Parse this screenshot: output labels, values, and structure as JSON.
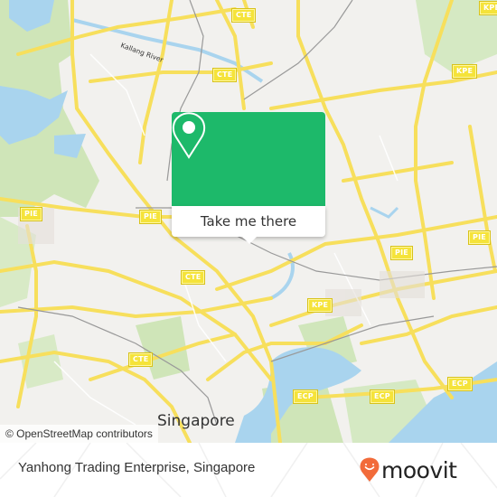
{
  "map": {
    "city_label": "Singapore",
    "river_label": "Kallang River",
    "attribution": "© OpenStreetMap contributors",
    "colors": {
      "land": "#f2f1ee",
      "park": "#cfe5b8",
      "water": "#a9d4ee",
      "major_road": "#f7df5c",
      "rail": "#999999"
    },
    "highway_shields": [
      {
        "label": "CTE"
      },
      {
        "label": "CTE"
      },
      {
        "label": "CTE"
      },
      {
        "label": "CTE"
      },
      {
        "label": "KPE"
      },
      {
        "label": "KPE"
      },
      {
        "label": "KPE"
      },
      {
        "label": "PIE"
      },
      {
        "label": "PIE"
      },
      {
        "label": "PIE"
      },
      {
        "label": "PIE"
      },
      {
        "label": "PIE"
      },
      {
        "label": "ECP"
      },
      {
        "label": "ECP"
      },
      {
        "label": "ECP"
      }
    ]
  },
  "popup": {
    "button_label": "Take me there",
    "accent_color": "#1db96a",
    "icon": "map-pin-icon"
  },
  "footer": {
    "place_title": "Yanhong Trading Enterprise, Singapore",
    "brand": "moovit",
    "brand_icon": "moovit-smile-pin-icon",
    "brand_color": "#f26b3a"
  }
}
